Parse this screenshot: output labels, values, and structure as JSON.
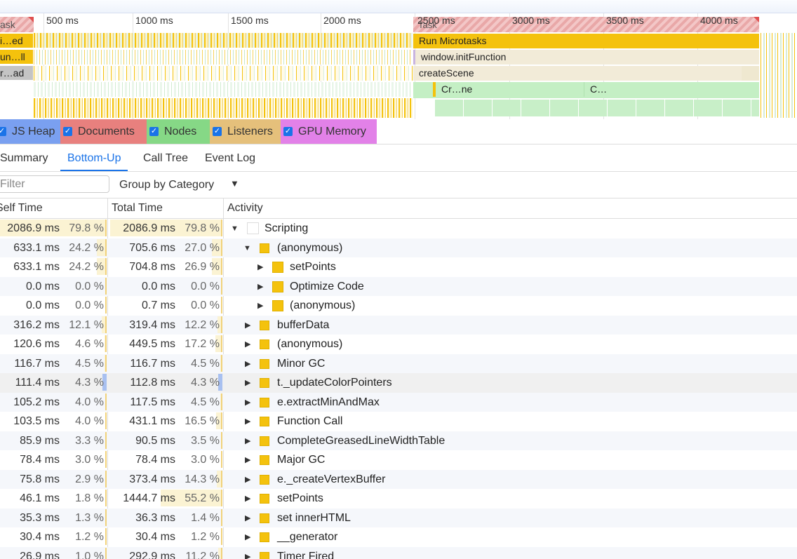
{
  "flame": {
    "ticks": [
      "500 ms",
      "1000 ms",
      "1500 ms",
      "2000 ms",
      "2500 ms",
      "3000 ms",
      "3500 ms",
      "4000 ms"
    ],
    "side_labels": [
      "ask",
      "i…ed",
      "un…ll",
      "r…ad"
    ],
    "task_label": "Task",
    "bars": {
      "run_microtasks": "Run Microtasks",
      "init_function": "window.initFunction",
      "create_scene": "createScene",
      "cr_ne": "Cr…ne",
      "c_short": "C…"
    }
  },
  "counters": [
    {
      "label": "JS Heap",
      "checked": true,
      "color": "#7aa0f0"
    },
    {
      "label": "Documents",
      "checked": true,
      "color": "#e8807e"
    },
    {
      "label": "Nodes",
      "checked": true,
      "color": "#86d886"
    },
    {
      "label": "Listeners",
      "checked": true,
      "color": "#e5c07b"
    },
    {
      "label": "GPU Memory",
      "checked": true,
      "color": "#e281e8"
    }
  ],
  "tabs": [
    "Summary",
    "Bottom-Up",
    "Call Tree",
    "Event Log"
  ],
  "active_tab": "Bottom-Up",
  "filter": {
    "placeholder": "Filter",
    "group_by": "Group by Category"
  },
  "columns": {
    "self": "Self Time",
    "total": "Total Time",
    "activity": "Activity"
  },
  "rows": [
    {
      "self": "2086.9 ms",
      "self_pct": "79.8 %",
      "self_frac": 0.798,
      "total": "2086.9 ms",
      "total_pct": "79.8 %",
      "total_frac": 0.798,
      "depth": 0,
      "toggle": "expanded",
      "color": "white",
      "name": "Scripting"
    },
    {
      "self": "633.1 ms",
      "self_pct": "24.2 %",
      "self_frac": 0.242,
      "total": "705.6 ms",
      "total_pct": "27.0 %",
      "total_frac": 0.27,
      "depth": 1,
      "toggle": "expanded",
      "color": "yellow",
      "name": "(anonymous)"
    },
    {
      "self": "633.1 ms",
      "self_pct": "24.2 %",
      "self_frac": 0.242,
      "total": "704.8 ms",
      "total_pct": "26.9 %",
      "total_frac": 0.269,
      "depth": 2,
      "toggle": "collapsed",
      "color": "yellow",
      "name": "setPoints"
    },
    {
      "self": "0.0 ms",
      "self_pct": "0.0 %",
      "self_frac": 0,
      "total": "0.0 ms",
      "total_pct": "0.0 %",
      "total_frac": 0,
      "depth": 2,
      "toggle": "collapsed",
      "color": "yellow",
      "name": "Optimize Code"
    },
    {
      "self": "0.0 ms",
      "self_pct": "0.0 %",
      "self_frac": 0,
      "total": "0.7 ms",
      "total_pct": "0.0 %",
      "total_frac": 0,
      "depth": 2,
      "toggle": "collapsed",
      "color": "yellow",
      "name": "(anonymous)"
    },
    {
      "self": "316.2 ms",
      "self_pct": "12.1 %",
      "self_frac": 0.121,
      "total": "319.4 ms",
      "total_pct": "12.2 %",
      "total_frac": 0.122,
      "depth": 1,
      "toggle": "collapsed",
      "color": "yellow",
      "name": "bufferData"
    },
    {
      "self": "120.6 ms",
      "self_pct": "4.6 %",
      "self_frac": 0.046,
      "total": "449.5 ms",
      "total_pct": "17.2 %",
      "total_frac": 0.172,
      "depth": 1,
      "toggle": "collapsed",
      "color": "yellow",
      "name": "(anonymous)"
    },
    {
      "self": "116.7 ms",
      "self_pct": "4.5 %",
      "self_frac": 0.045,
      "total": "116.7 ms",
      "total_pct": "4.5 %",
      "total_frac": 0.045,
      "depth": 1,
      "toggle": "collapsed",
      "color": "yellow",
      "name": "Minor GC"
    },
    {
      "self": "111.4 ms",
      "self_pct": "4.3 %",
      "self_frac": 0.043,
      "total": "112.8 ms",
      "total_pct": "4.3 %",
      "total_frac": 0.043,
      "depth": 1,
      "toggle": "collapsed",
      "color": "yellow",
      "name": "t._updateColorPointers",
      "selected": true
    },
    {
      "self": "105.2 ms",
      "self_pct": "4.0 %",
      "self_frac": 0.04,
      "total": "117.5 ms",
      "total_pct": "4.5 %",
      "total_frac": 0.045,
      "depth": 1,
      "toggle": "collapsed",
      "color": "yellow",
      "name": "e.extractMinAndMax"
    },
    {
      "self": "103.5 ms",
      "self_pct": "4.0 %",
      "self_frac": 0.04,
      "total": "431.1 ms",
      "total_pct": "16.5 %",
      "total_frac": 0.165,
      "depth": 1,
      "toggle": "collapsed",
      "color": "yellow",
      "name": "Function Call"
    },
    {
      "self": "85.9 ms",
      "self_pct": "3.3 %",
      "self_frac": 0.033,
      "total": "90.5 ms",
      "total_pct": "3.5 %",
      "total_frac": 0.035,
      "depth": 1,
      "toggle": "collapsed",
      "color": "yellow",
      "name": "CompleteGreasedLineWidthTable"
    },
    {
      "self": "78.4 ms",
      "self_pct": "3.0 %",
      "self_frac": 0.03,
      "total": "78.4 ms",
      "total_pct": "3.0 %",
      "total_frac": 0.03,
      "depth": 1,
      "toggle": "collapsed",
      "color": "yellow",
      "name": "Major GC"
    },
    {
      "self": "75.8 ms",
      "self_pct": "2.9 %",
      "self_frac": 0.029,
      "total": "373.4 ms",
      "total_pct": "14.3 %",
      "total_frac": 0.143,
      "depth": 1,
      "toggle": "collapsed",
      "color": "yellow",
      "name": "e._createVertexBuffer"
    },
    {
      "self": "46.1 ms",
      "self_pct": "1.8 %",
      "self_frac": 0.018,
      "total": "1444.7 ms",
      "total_pct": "55.2 %",
      "total_frac": 0.552,
      "depth": 1,
      "toggle": "collapsed",
      "color": "yellow",
      "name": "setPoints"
    },
    {
      "self": "35.3 ms",
      "self_pct": "1.3 %",
      "self_frac": 0.013,
      "total": "36.3 ms",
      "total_pct": "1.4 %",
      "total_frac": 0.014,
      "depth": 1,
      "toggle": "collapsed",
      "color": "yellow",
      "name": "set innerHTML"
    },
    {
      "self": "30.4 ms",
      "self_pct": "1.2 %",
      "self_frac": 0.012,
      "total": "30.4 ms",
      "total_pct": "1.2 %",
      "total_frac": 0.012,
      "depth": 1,
      "toggle": "collapsed",
      "color": "yellow",
      "name": "__generator"
    },
    {
      "self": "26.9 ms",
      "self_pct": "1.0 %",
      "self_frac": 0.01,
      "total": "292.9 ms",
      "total_pct": "11.2 %",
      "total_frac": 0.112,
      "depth": 1,
      "toggle": "collapsed",
      "color": "yellow",
      "name": "Timer Fired"
    }
  ]
}
